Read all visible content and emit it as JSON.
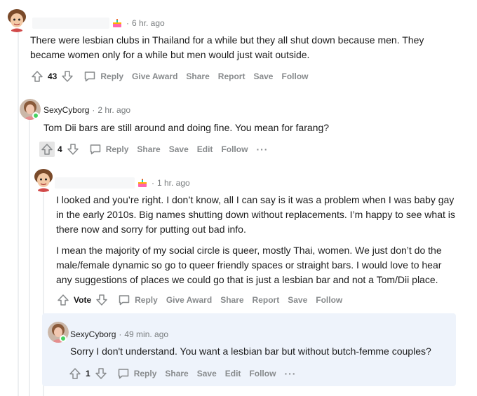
{
  "comments": [
    {
      "time": "6 hr. ago",
      "text": "There were lesbian clubs in Thailand for a while but they all shut down because men. They became women only for a while but men would just wait outside.",
      "score": "43",
      "actions": [
        "Reply",
        "Give Award",
        "Share",
        "Report",
        "Save",
        "Follow"
      ]
    },
    {
      "user": "SexyCyborg",
      "time": "2 hr. ago",
      "text": "Tom Dii bars are still around and doing fine. You mean for farang?",
      "score": "4",
      "actions": [
        "Reply",
        "Share",
        "Save",
        "Edit",
        "Follow"
      ],
      "more": "···"
    },
    {
      "time": "1 hr. ago",
      "paragraphs": [
        "I looked and you’re right. I don’t know, all I can say is it was a problem when I was baby gay in the early 2010s. Big names shutting down without replacements. I’m happy to see what is there now and sorry for putting out bad info.",
        "I mean the majority of my social circle is queer, mostly Thai, women. We just don’t do the male/female dynamic so go to queer friendly spaces or straight bars. I would love to hear any suggestions of places we could go that is just a lesbian bar and not a Tom/Dii place."
      ],
      "score": "Vote",
      "actions": [
        "Reply",
        "Give Award",
        "Share",
        "Report",
        "Save",
        "Follow"
      ]
    },
    {
      "user": "SexyCyborg",
      "time": "49 min. ago",
      "text": "Sorry I don't understand. You want a lesbian bar but without butch-femme couples?",
      "score": "1",
      "actions": [
        "Reply",
        "Share",
        "Save",
        "Edit",
        "Follow"
      ],
      "more": "···"
    }
  ],
  "meta_separator": "·",
  "icons": {
    "upvote": "upvote-arrow-icon",
    "downvote": "downvote-arrow-icon",
    "reply": "speech-bubble-icon",
    "cake": "cake-day-icon",
    "avatar": "user-avatar"
  },
  "colors": {
    "text": "#1c1c1c",
    "meta": "#787c7e",
    "action": "#878a8c",
    "highlight": "#eef3fb",
    "online": "#46d160"
  }
}
